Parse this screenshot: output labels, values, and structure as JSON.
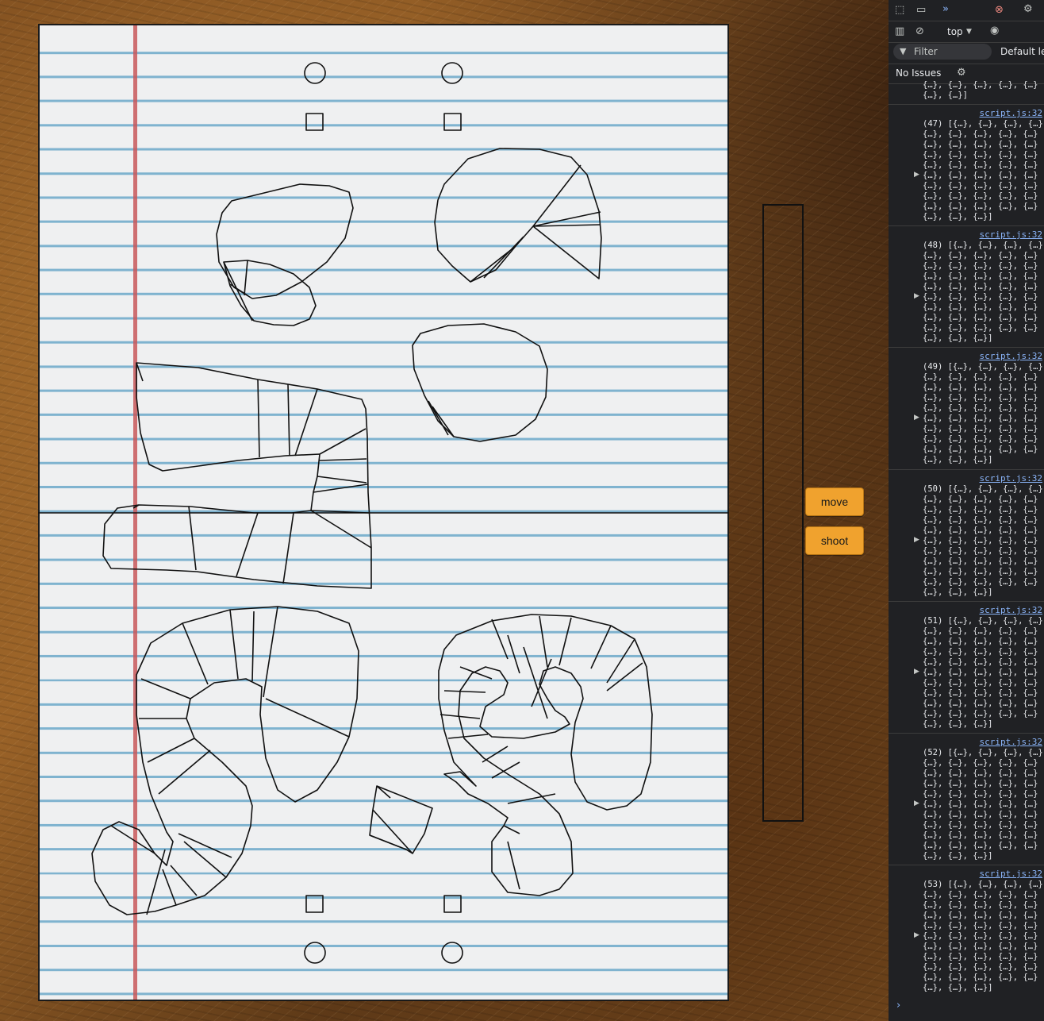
{
  "controls": {
    "move_label": "move",
    "shoot_label": "shoot",
    "button_color": "#f0a22e"
  },
  "devtools": {
    "context_label": "top",
    "filter_placeholder": "Filter",
    "levels_label": "Default le",
    "issues_label": "No Issues",
    "top_fragment_1": "{…}, {…}, {…}, {…}, {…}",
    "top_fragment_2": "{…}, {…}]",
    "logs": [
      {
        "count": "(47)",
        "source": "script.js:32",
        "lines": 10
      },
      {
        "count": "(48)",
        "source": "script.js:32",
        "lines": 10
      },
      {
        "count": "(49)",
        "source": "script.js:32",
        "lines": 10
      },
      {
        "count": "(50)",
        "source": "script.js:32",
        "lines": 11
      },
      {
        "count": "(51)",
        "source": "script.js:32",
        "lines": 11
      },
      {
        "count": "(52)",
        "source": "script.js:32",
        "lines": 11
      },
      {
        "count": "(53)",
        "source": "script.js:32",
        "lines": 11
      }
    ]
  },
  "icons": [
    "inspect-icon",
    "device-toggle-icon",
    "more-tabs-icon",
    "error-badge-icon",
    "settings-gear-icon",
    "sidebar-icon",
    "clear-console-icon",
    "eye-icon",
    "filter-icon"
  ],
  "colors": {
    "paper": "#eff0f1",
    "rule_lines": "#7fb3cf",
    "margin_line": "#c8585a",
    "devtools_bg": "#202124",
    "link": "#8ab4f8"
  }
}
